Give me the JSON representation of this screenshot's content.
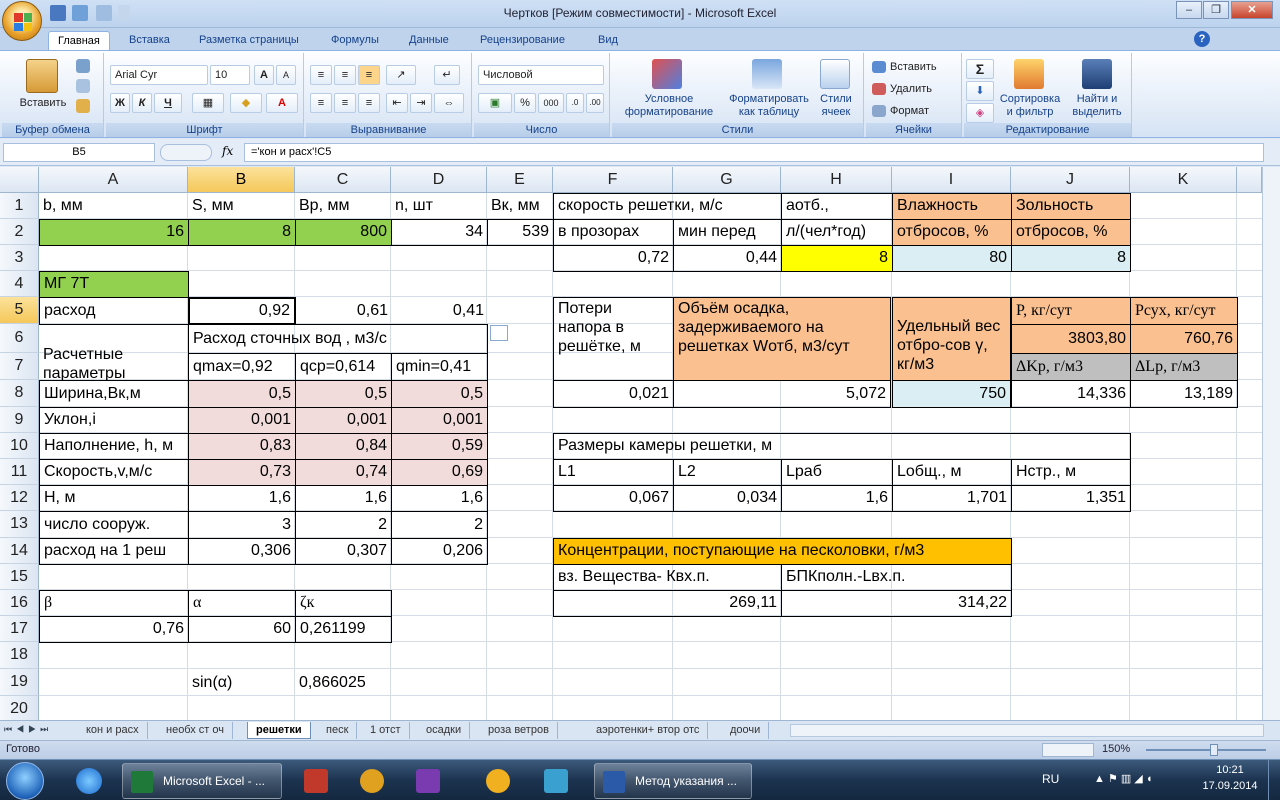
{
  "window": {
    "title": "Чертков  [Режим совместимости] - Microsoft Excel",
    "minimize": "–",
    "restore": "❐",
    "close": "✕"
  },
  "ribbon_tabs": [
    "Главная",
    "Вставка",
    "Разметка страницы",
    "Формулы",
    "Данные",
    "Рецензирование",
    "Вид"
  ],
  "ribbon": {
    "paste_label": "Вставить",
    "font_name": "Arial Cyr",
    "font_size": "10",
    "number_format": "Числовой",
    "bold": "Ж",
    "italic": "К",
    "underline": "Ч",
    "grow_font": "A",
    "shrink_font": "A",
    "percent": "%",
    "thousands": "000",
    "cond_format_1": "Условное",
    "cond_format_2": "форматирование",
    "format_table_1": "Форматировать",
    "format_table_2": "как таблицу",
    "cell_styles_1": "Стили",
    "cell_styles_2": "ячеек",
    "insert": "Вставить",
    "delete": "Удалить",
    "format": "Формат",
    "sum": "Σ",
    "sort_1": "Сортировка",
    "sort_2": "и фильтр",
    "find_1": "Найти и",
    "find_2": "выделить",
    "groups": [
      "Буфер обмена",
      "Шрифт",
      "Выравнивание",
      "Число",
      "Стили",
      "Ячейки",
      "Редактирование"
    ]
  },
  "formula_bar": {
    "name_box": "B5",
    "fx": "fx",
    "formula": "='кон и расх'!C5"
  },
  "columns": [
    "A",
    "B",
    "C",
    "D",
    "E",
    "F",
    "G",
    "H",
    "I",
    "J",
    "K"
  ],
  "rows": [
    "1",
    "2",
    "3",
    "4",
    "5",
    "6",
    "7",
    "8",
    "9",
    "10",
    "11",
    "12",
    "13",
    "14",
    "15",
    "16",
    "17",
    "18",
    "19",
    "20"
  ],
  "cells": {
    "A1": "b, мм",
    "B1": "S, мм",
    "C1": "Bp, мм",
    "D1": "n, шт",
    "E1": "Bк, мм",
    "F1": "скорость  решетки, м/с",
    "H1": "aотб.,",
    "I1": "Влажность",
    "J1": "Зольность",
    "A2": "16",
    "B2": "8",
    "C2": "800",
    "D2": "34",
    "E2": "539",
    "F2": "в прозорах",
    "G2": "мин перед",
    "H2": "л/(чел*год)",
    "I2": "отбросов, %",
    "J2": "отбросов, %",
    "F3": "0,72",
    "G3": "0,44",
    "H3": "8",
    "I3": "80",
    "J3": "8",
    "A4": "МГ 7Т",
    "A5": "расход",
    "B5": "0,92",
    "C5": "0,61",
    "D5": "0,41",
    "F5": "Потери напора в решётке, м",
    "G5": "Объём осадка, задерживаемого на решетках Wотб, м3/сут",
    "H5": "Удельный вес отбро-сов γ, кг/м3",
    "J5": "P, кг/сут",
    "K5": "Pсух, кг/сут",
    "A6": "Расчетные параметры",
    "B6": "Расход сточных вод  , м3/с",
    "J6": "3803,80",
    "K6": "760,76",
    "B7": "qmax=0,92",
    "C7": "qср=0,614",
    "D7": "qmin=0,41",
    "J7": "ΔKp, г/м3",
    "K7": "ΔLp, г/м3",
    "A8": "Ширина,Вк,м",
    "B8": "0,5",
    "C8": "0,5",
    "D8": "0,5",
    "F8": "0,021",
    "G8": "5,072",
    "H8": "750",
    "J8": "14,336",
    "K8": "13,189",
    "A9": "Уклон,i",
    "B9": "0,001",
    "C9": "0,001",
    "D9": "0,001",
    "A10": "Наполнение, h, м",
    "B10": "0,83",
    "C10": "0,84",
    "D10": "0,59",
    "F10": "Размеры камеры решетки, м",
    "A11": "Скорость,v,м/с",
    "B11": "0,73",
    "C11": "0,74",
    "D11": "0,69",
    "F11": "L1",
    "G11": "L2",
    "H11": "Lраб",
    "I11": "Lобщ., м",
    "J11": "Нстр., м",
    "A12": "Н, м",
    "B12": "1,6",
    "C12": "1,6",
    "D12": "1,6",
    "F12": "0,067",
    "G12": "0,034",
    "H12": "1,6",
    "I12": "1,701",
    "J12": "1,351",
    "A13": "число сооруж.",
    "B13": "3",
    "C13": "2",
    "D13": "2",
    "A14": "расход на 1 реш",
    "B14": "0,306",
    "C14": "0,307",
    "D14": "0,206",
    "F14": "Концентрации, поступающие на песколовки, г/м3",
    "F15": "вз. Вещества- Квх.п.",
    "H15": "БПКполн.-Lвх.п.",
    "F16": "269,11",
    "H16": "314,22",
    "A16": "β",
    "B16": "α",
    "C16": "ζк",
    "A17": "0,76",
    "B17": "60",
    "C17": "0,261199",
    "B19": "sin(α)",
    "C19": "0,866025"
  },
  "sheet_tabs": [
    "кон и расх",
    "необх ст оч",
    "решетки",
    "песк",
    "1 отст",
    "осадки",
    "роза ветров",
    "аэротенки+ втор отс",
    "доочи"
  ],
  "status": {
    "ready": "Готово",
    "zoom": "150%"
  },
  "taskbar": {
    "excel": "Microsoft Excel - ...",
    "word": "Метод указания ...",
    "lang": "RU",
    "time": "10:21",
    "date": "17.09.2014"
  },
  "colors": {
    "green": "#92d050",
    "orange": "#fac090",
    "yellow": "#ffff00",
    "light_blue": "#daeef3",
    "pink": "#f2dcdb",
    "gold": "#ffc000"
  }
}
